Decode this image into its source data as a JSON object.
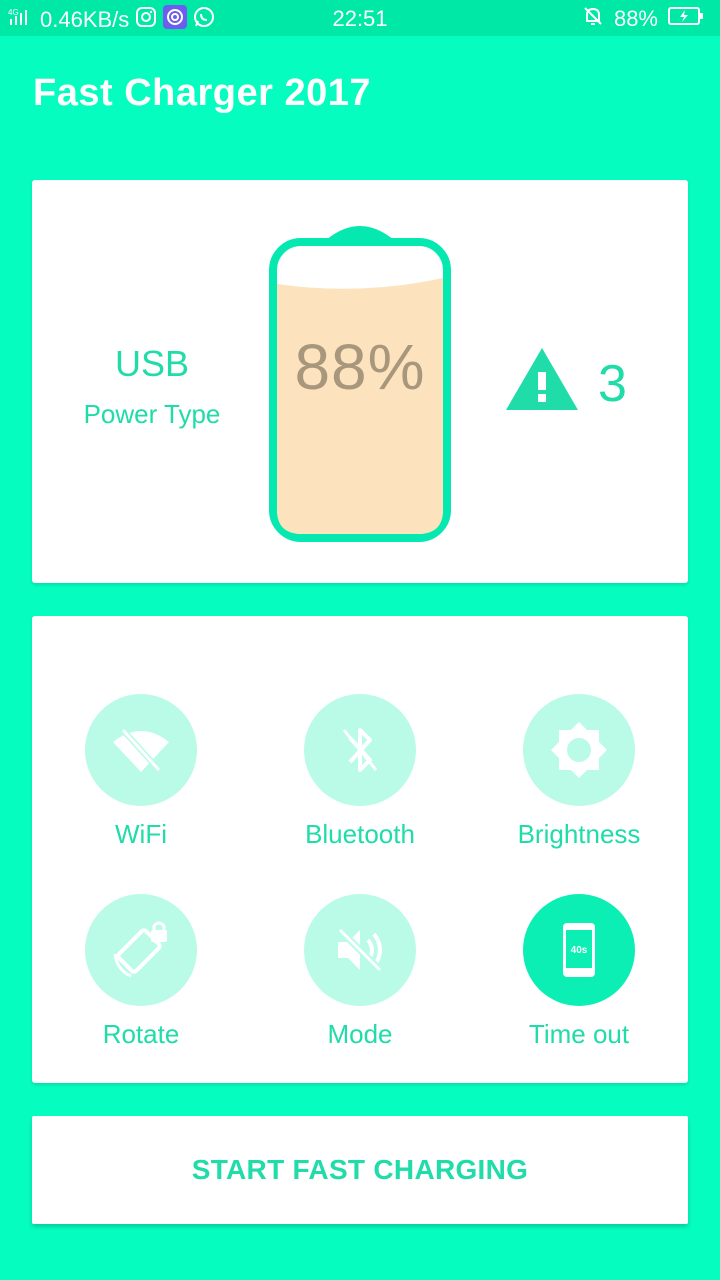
{
  "status_bar": {
    "network": "4G",
    "speed": "0.46KB/s",
    "time": "22:51",
    "battery_percent": "88%",
    "icons": [
      "signal-icon",
      "instagram-icon",
      "app-icon",
      "whatsapp-icon",
      "mute-bell-icon",
      "battery-charging-icon"
    ]
  },
  "app": {
    "title": "Fast Charger 2017"
  },
  "battery": {
    "power_type_value": "USB",
    "power_type_label": "Power Type",
    "level": "88%",
    "level_fraction": 0.88,
    "warning_count": "3"
  },
  "toggles": [
    {
      "label": "WiFi",
      "icon": "wifi-off-icon",
      "active": false
    },
    {
      "label": "Bluetooth",
      "icon": "bluetooth-off-icon",
      "active": false
    },
    {
      "label": "Brightness",
      "icon": "brightness-icon",
      "active": false
    },
    {
      "label": "Rotate",
      "icon": "rotate-lock-icon",
      "active": false
    },
    {
      "label": "Mode",
      "icon": "volume-off-icon",
      "active": false
    },
    {
      "label": "Time out",
      "icon": "screen-timeout-icon",
      "active": true,
      "badge": "40s"
    }
  ],
  "actions": {
    "start_label": "START FAST CHARGING"
  },
  "colors": {
    "background": "#05fdbf",
    "status_bar": "#00e8a6",
    "accent": "#1fdca9",
    "circle_inactive": "#b9fbe7",
    "circle_active": "#0cefb4",
    "battery_fill": "#fde3bd",
    "percent_text": "#a8977c"
  }
}
